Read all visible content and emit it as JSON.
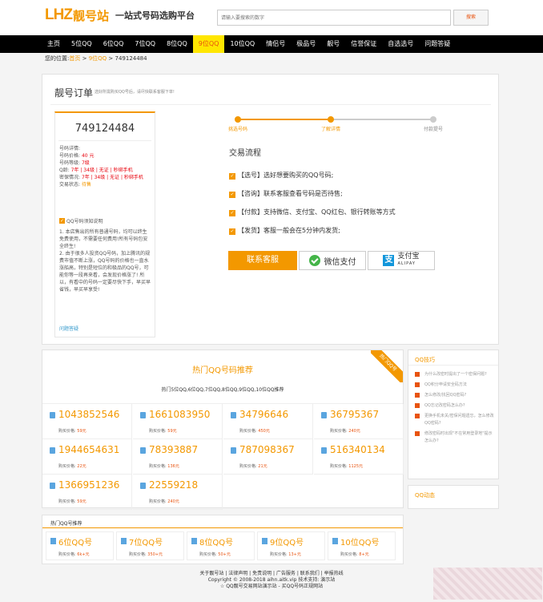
{
  "header": {
    "logo_latin": "LHZ",
    "logo_cn": "靓号站",
    "slogan": "一站式号码选购平台",
    "search_placeholder": "请输入要搜索的数字",
    "search_button": "搜索"
  },
  "nav": [
    "主页",
    "5位QQ",
    "6位QQ",
    "7位QQ",
    "8位QQ",
    "9位QQ",
    "10位QQ",
    "情侣号",
    "极品号",
    "靓号",
    "信誉保证",
    "自选选号",
    "问题答疑"
  ],
  "crumb": {
    "prefix": "您的位置:",
    "home": "首页",
    "sep1": " > ",
    "cat": "9位QQ",
    "sep2": " > ",
    "num": "749124484"
  },
  "order": {
    "title": "靓号订单",
    "subtitle": "选好所需购买QQ号后，请尽快联系客服下单!",
    "number": "749124484",
    "details_label": "号码详情:",
    "details": [
      {
        "k": "号码价格: ",
        "v": "40 元",
        "c": "r"
      },
      {
        "k": "号码等级: ",
        "v": "7级",
        "c": "r"
      },
      {
        "k": "Q龄: ",
        "v": "7年 | 34级 | 无证 | 秒绑手机",
        "c": "r"
      },
      {
        "k": "密保情况: ",
        "v": "7年 | 34级 | 无证 | 秒绑手机",
        "c": "r"
      },
      {
        "k": "交易状态: ",
        "v": "待售",
        "c": "o"
      }
    ],
    "notice_title": "QQ号码须知说明",
    "notice": "1. 本店售出的所有普通号码，均可以终生免费使用，不需要任何费用!所有号码包安全终生!\n2. 由于很多人投资QQ号码，加上腾讯的规费市值不断上涨，QQ号码的价格也一直水涨船高，特别是短位的和极品的QQ号，可能你等一段再来看，会发现价格涨了! 所以，有看中的号码一定要尽快下手，早买早省钱，早买早享受!",
    "faq": "问题答疑",
    "steps": [
      "挑选号码",
      "了解详情",
      "付款提号"
    ],
    "flow_title": "交易流程",
    "flow": [
      "【选号】选好想要购买的QQ号码;",
      "【咨询】联系客服查看号码是否待售;",
      "【付款】支持微信、支付宝、QQ红包、银行转账等方式",
      "【发货】客服一般会在5分钟内发货;"
    ],
    "btn_service": "联系客服",
    "btn_wechat": "微信支付",
    "btn_alipay_cn": "支付宝",
    "btn_alipay_en": "ALIPAY"
  },
  "hot": {
    "title": "热门QQ号码推荐",
    "subtitle": "热门5位QQ,6位QQ,7位QQ,8位QQ,9位QQ,10位QQ推荐",
    "ribbon": "热门QQ号",
    "price_label": "购买价格: ",
    "items": [
      {
        "num": "1043852546",
        "price": "59元"
      },
      {
        "num": "1661083950",
        "price": "59元"
      },
      {
        "num": "34796646",
        "price": "450元"
      },
      {
        "num": "36795367",
        "price": "240元"
      },
      {
        "num": "1944654631",
        "price": "22元"
      },
      {
        "num": "78393887",
        "price": "136元"
      },
      {
        "num": "787098367",
        "price": "21元"
      },
      {
        "num": "516340134",
        "price": "1125元"
      },
      {
        "num": "1366951236",
        "price": "59元"
      },
      {
        "num": "22559218",
        "price": "240元"
      }
    ]
  },
  "cats": {
    "title": "热门QQ号推荐",
    "price_label": "购买价格: ",
    "items": [
      {
        "name": "6位QQ号",
        "price": "6k+元"
      },
      {
        "name": "7位QQ号",
        "price": "350+元"
      },
      {
        "name": "8位QQ号",
        "price": "50+元"
      },
      {
        "name": "9位QQ号",
        "price": "13+元"
      },
      {
        "name": "10位QQ号",
        "price": "8+元"
      }
    ]
  },
  "side": {
    "title": "QQ技巧",
    "items": [
      "为什么改密时提出了一个密保问题?",
      "QQ积分申请安全码方法",
      "怎么修改/找回QQ密码?",
      "QQ忘记改密码怎么办?",
      "更换手机未关/密保问题遗忘，怎么修改QQ密码?",
      "修改密码时出现\"不在常用登录地\"提示怎么办?"
    ],
    "dyn_title": "QQ动态"
  },
  "footer": [
    "关于靓号站 | 法律声明 | 免责说明 | 广告服务 | 联系我们 | 举报热线",
    "Copyright © 2008-2018 aihn.aitk.vip 技术支持: 演示站",
    "☆ QQ靓号交易网站演示站 - 买QQ号码正规网站"
  ]
}
